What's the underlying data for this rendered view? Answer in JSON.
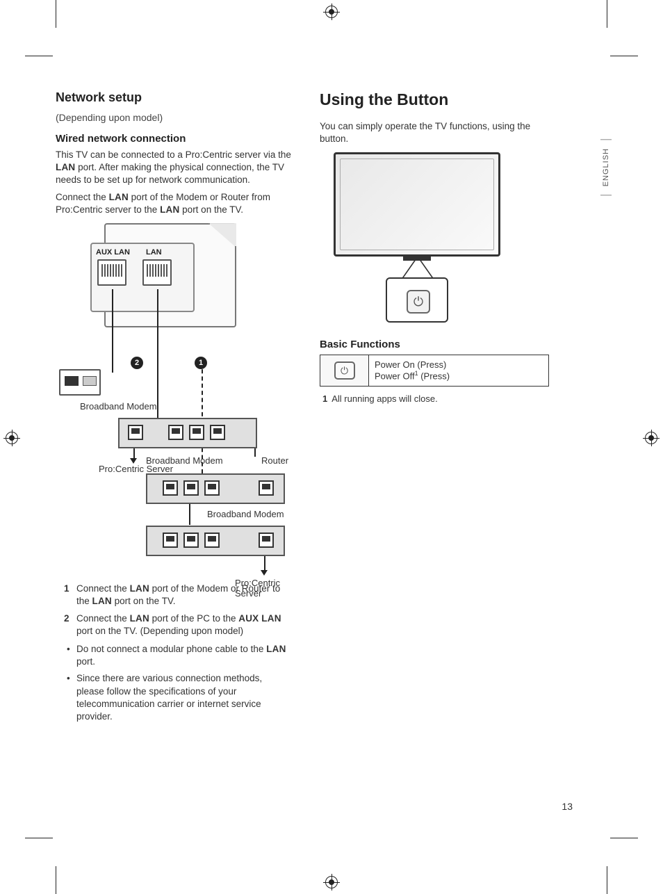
{
  "page_number": "13",
  "language_tab": "ENGLISH",
  "left": {
    "heading": "Network setup",
    "subnote": "(Depending upon model)",
    "sub_heading": "Wired network connection",
    "para1_a": "This TV can be connected to a Pro:Centric server via the ",
    "para1_b": "LAN",
    "para1_c": " port. After making the physical connection, the TV needs to be set up for network communication.",
    "para2_a": "Connect the ",
    "para2_b": "LAN",
    "para2_c": " port of the Modem or Router from Pro:Centric server to the ",
    "para2_d": "LAN",
    "para2_e": " port on the TV.",
    "diagram": {
      "aux_lan": "AUX LAN",
      "lan": "LAN",
      "marker1": "1",
      "marker2": "2",
      "broadband_modem_1": "Broadband Modem",
      "pro_centric_1": "Pro:Centric Server",
      "broadband_modem_2": "Broadband Modem",
      "router": "Router",
      "broadband_modem_3": "Broadband Modem",
      "pro_centric_2": "Pro:Centric Server"
    },
    "step1_num": "1",
    "step1_a": "Connect the ",
    "step1_b": "LAN",
    "step1_c": " port of the Modem or Router to the ",
    "step1_d": "LAN",
    "step1_e": " port on the TV.",
    "step2_num": "2",
    "step2_a": "Connect the ",
    "step2_b": "LAN",
    "step2_c": " port of the PC to the ",
    "step2_d": "AUX LAN",
    "step2_e": " port on the TV. (Depending upon model)",
    "bullet1_a": "Do not connect a modular phone cable to the ",
    "bullet1_b": "LAN",
    "bullet1_c": " port.",
    "bullet2": "Since there are various connection methods, please follow the specifications of your telecommunication carrier or internet service provider."
  },
  "right": {
    "heading": "Using the Button",
    "intro": "You can simply operate the TV functions, using the button.",
    "basic_heading": "Basic Functions",
    "power_on": "Power On (Press)",
    "power_off_a": "Power Off",
    "power_off_sup": "1",
    "power_off_b": " (Press)",
    "footnote_num": "1",
    "footnote_text": "All running apps will close."
  }
}
